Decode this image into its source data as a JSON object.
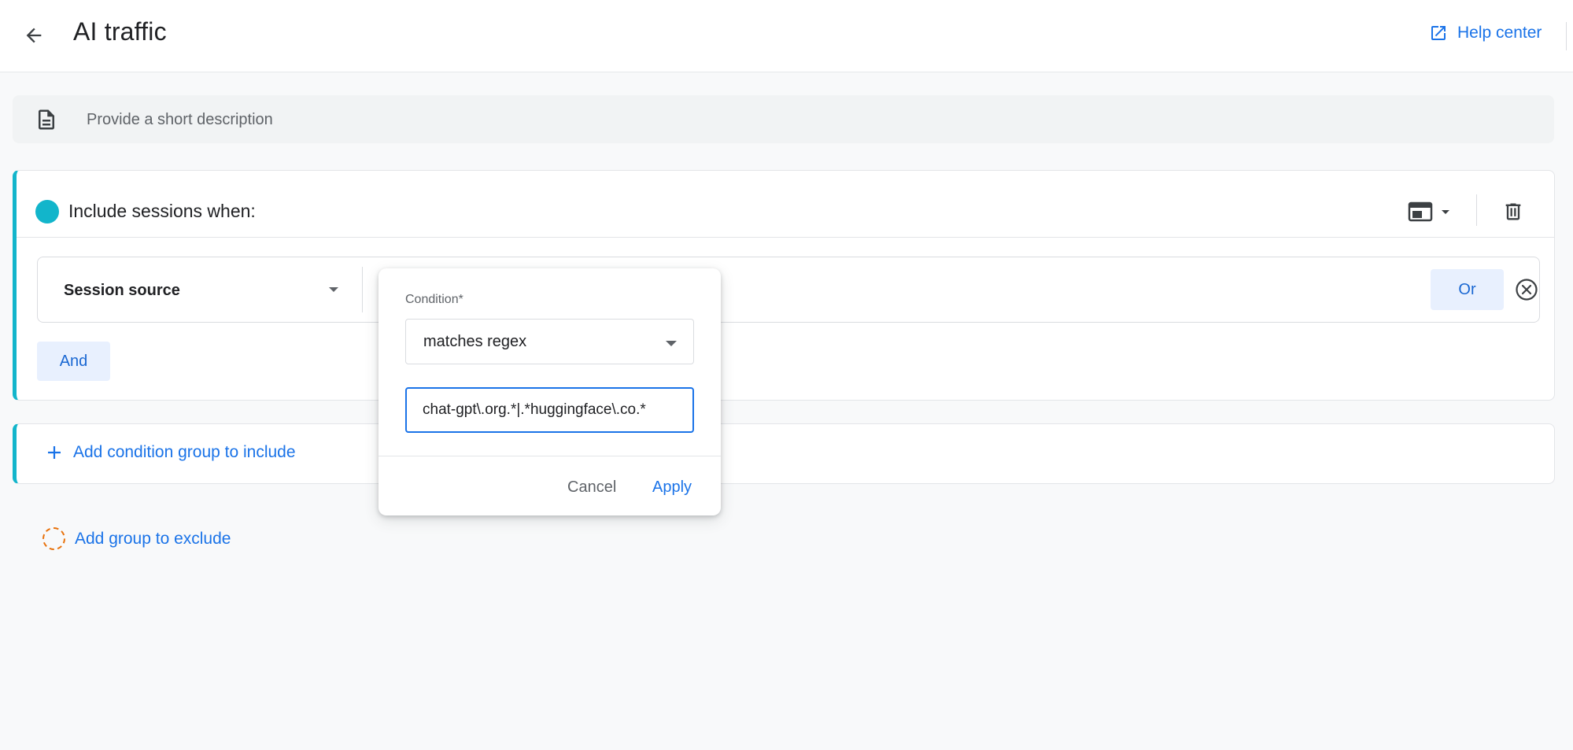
{
  "header": {
    "title": "AI traffic",
    "back_icon": "arrow-left-icon",
    "help_center_label": "Help center",
    "help_icon": "open-in-new-icon"
  },
  "description": {
    "placeholder": "Provide a short description",
    "icon": "document-icon"
  },
  "include_group": {
    "title": "Include sessions when:",
    "accent_color": "#12b5cb",
    "condition": {
      "dimension": "Session source"
    },
    "or_label": "Or",
    "and_label": "And"
  },
  "add_condition_group_label": "Add condition group to include",
  "add_exclude_label": "Add group to exclude",
  "exclude_color": "#e8710a",
  "popup": {
    "condition_label": "Condition*",
    "condition_value": "matches regex",
    "value_text": "chat-gpt\\.org.*|.*huggingface\\.co.*",
    "cancel_label": "Cancel",
    "apply_label": "Apply"
  },
  "colors": {
    "link_blue": "#1a73e8",
    "chip_bg": "#e8f0fe"
  }
}
